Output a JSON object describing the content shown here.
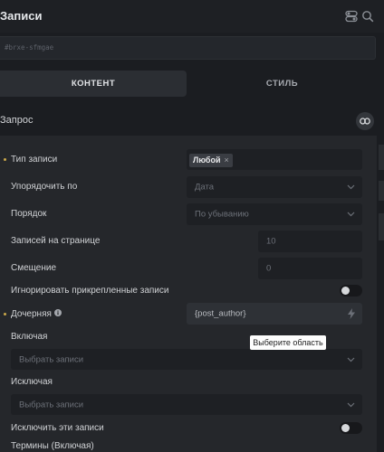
{
  "header": {
    "title": "Записи"
  },
  "element_id": "#brxe-sfmgae",
  "tabs": {
    "content": "КОНТЕНТ",
    "style": "СТИЛЬ"
  },
  "section": {
    "title": "Запрос"
  },
  "fields": {
    "post_type": {
      "label": "Тип записи",
      "tag": "Любой",
      "tag_remove": "×"
    },
    "orderby": {
      "label": "Упорядочить по",
      "value": "Дата"
    },
    "order": {
      "label": "Порядок",
      "value": "По убыванию"
    },
    "per_page": {
      "label": "Записей на странице",
      "value": "10"
    },
    "offset": {
      "label": "Смещение",
      "value": "0"
    },
    "ignore_sticky": {
      "label": "Игнорировать прикрепленные записи",
      "on": false
    },
    "child_of": {
      "label": "Дочерняя",
      "value": "{post_author}"
    },
    "include": {
      "label": "Включая",
      "placeholder": "Выбрать записи"
    },
    "exclude": {
      "label": "Исключая",
      "placeholder": "Выбрать записи"
    },
    "exclude_current": {
      "label": "Исключить эти записи",
      "on": false
    },
    "terms_include": {
      "label": "Термины (Включая)"
    }
  },
  "tooltip": "Выберите область",
  "icons": [
    "toggle-icon",
    "search-icon",
    "link-icon",
    "info-icon",
    "bolt-icon",
    "chevron-down-icon",
    "close-icon"
  ],
  "colors": {
    "background": "#1b1d21",
    "panel": "#25272b",
    "input": "#1e2024",
    "accent_dot": "#c9a74a"
  }
}
